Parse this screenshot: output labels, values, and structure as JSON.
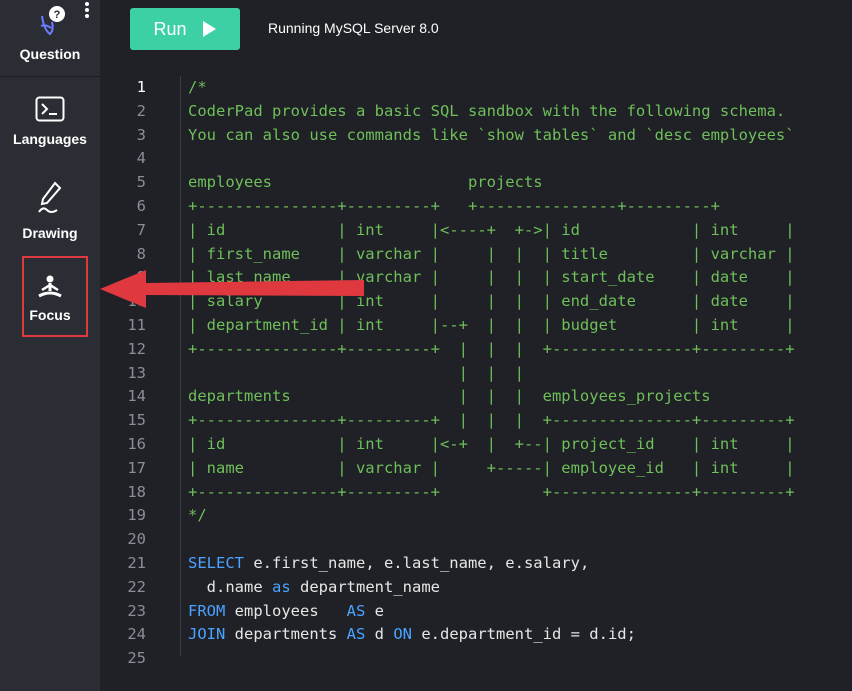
{
  "sidebar": {
    "question": {
      "label": "Question"
    },
    "languages": {
      "label": "Languages"
    },
    "drawing": {
      "label": "Drawing"
    },
    "focus": {
      "label": "Focus"
    }
  },
  "toolbar": {
    "run_label": "Run",
    "status": "Running MySQL Server 8.0"
  },
  "colors": {
    "accent": "#3ed0a5",
    "highlight": "#e0383f",
    "comment": "#6fbf5a",
    "keyword": "#4aa3ff"
  },
  "editor": {
    "lines": [
      {
        "n": "1",
        "segs": [
          [
            "c",
            "/*"
          ]
        ]
      },
      {
        "n": "2",
        "segs": [
          [
            "c",
            "CoderPad provides a basic SQL sandbox with the following schema."
          ]
        ]
      },
      {
        "n": "3",
        "segs": [
          [
            "c",
            "You can also use commands like `show tables` and `desc employees`"
          ]
        ]
      },
      {
        "n": "4",
        "segs": []
      },
      {
        "n": "5",
        "segs": [
          [
            "c",
            "employees                     projects"
          ]
        ]
      },
      {
        "n": "6",
        "segs": [
          [
            "c",
            "+---------------+---------+   +---------------+---------+"
          ]
        ]
      },
      {
        "n": "7",
        "segs": [
          [
            "c",
            "| id            | int     |<----+  +->| id            | int     |"
          ]
        ]
      },
      {
        "n": "8",
        "segs": [
          [
            "c",
            "| first_name    | varchar |     |  |  | title         | varchar |"
          ]
        ]
      },
      {
        "n": "9",
        "segs": [
          [
            "c",
            "| last_name     | varchar |     |  |  | start_date    | date    |"
          ]
        ]
      },
      {
        "n": "10",
        "segs": [
          [
            "c",
            "| salary        | int     |     |  |  | end_date      | date    |"
          ]
        ]
      },
      {
        "n": "11",
        "segs": [
          [
            "c",
            "| department_id | int     |--+  |  |  | budget        | int     |"
          ]
        ]
      },
      {
        "n": "12",
        "segs": [
          [
            "c",
            "+---------------+---------+  |  |  |  +---------------+---------+"
          ]
        ]
      },
      {
        "n": "13",
        "segs": [
          [
            "c",
            "                             |  |  |"
          ]
        ]
      },
      {
        "n": "14",
        "segs": [
          [
            "c",
            "departments                  |  |  |  employees_projects"
          ]
        ]
      },
      {
        "n": "15",
        "segs": [
          [
            "c",
            "+---------------+---------+  |  |  |  +---------------+---------+"
          ]
        ]
      },
      {
        "n": "16",
        "segs": [
          [
            "c",
            "| id            | int     |<-+  |  +--| project_id    | int     |"
          ]
        ]
      },
      {
        "n": "17",
        "segs": [
          [
            "c",
            "| name          | varchar |     +-----| employee_id   | int     |"
          ]
        ]
      },
      {
        "n": "18",
        "segs": [
          [
            "c",
            "+---------------+---------+           +---------------+---------+"
          ]
        ]
      },
      {
        "n": "19",
        "segs": [
          [
            "c",
            "*/"
          ]
        ]
      },
      {
        "n": "20",
        "segs": []
      },
      {
        "n": "21",
        "segs": [
          [
            "k",
            "SELECT"
          ],
          [
            "p",
            " e.first_name, e.last_name, e.salary,"
          ]
        ]
      },
      {
        "n": "22",
        "segs": [
          [
            "p",
            "  d.name "
          ],
          [
            "k",
            "as"
          ],
          [
            "p",
            " department_name"
          ]
        ]
      },
      {
        "n": "23",
        "segs": [
          [
            "k",
            "FROM"
          ],
          [
            "p",
            " employees   "
          ],
          [
            "k",
            "AS"
          ],
          [
            "p",
            " e"
          ]
        ]
      },
      {
        "n": "24",
        "segs": [
          [
            "k",
            "JOIN"
          ],
          [
            "p",
            " departments "
          ],
          [
            "k",
            "AS"
          ],
          [
            "p",
            " d "
          ],
          [
            "k",
            "ON"
          ],
          [
            "p",
            " e.department_id = d.id;"
          ]
        ]
      },
      {
        "n": "25",
        "segs": []
      }
    ]
  }
}
